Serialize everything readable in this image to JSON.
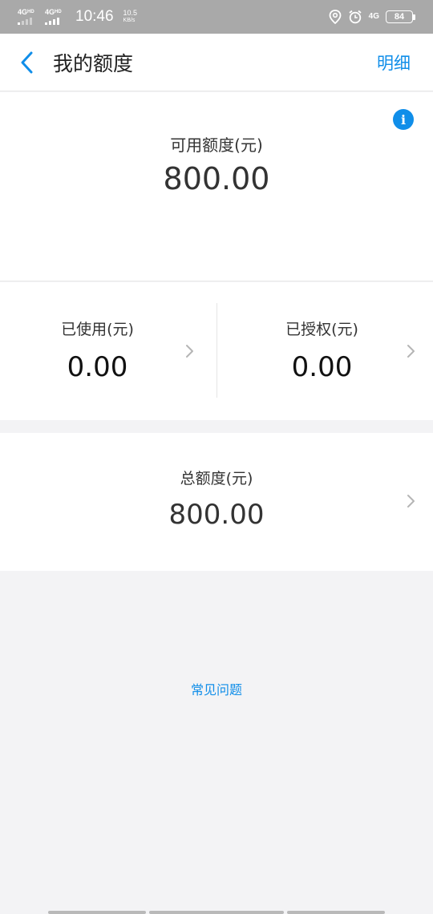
{
  "status_bar": {
    "network1": "4G",
    "network1_sup": "HD",
    "network2": "4G",
    "network2_sup": "HD",
    "time": "10:46",
    "speed_value": "10.5",
    "speed_unit": "KB/s",
    "network3": "4G",
    "battery": "84"
  },
  "header": {
    "title": "我的额度",
    "detail_link": "明细"
  },
  "available": {
    "label": "可用额度(元)",
    "value": "800.00"
  },
  "used": {
    "label": "已使用(元)",
    "value": "0.00"
  },
  "authorized": {
    "label": "已授权(元)",
    "value": "0.00"
  },
  "total": {
    "label": "总额度(元)",
    "value": "800.00"
  },
  "faq": {
    "label": "常见问题"
  },
  "colors": {
    "accent": "#108ee9",
    "status_bar": "#a9a9a9",
    "background": "#f3f3f5"
  },
  "icons": [
    "back-arrow-icon",
    "info-icon",
    "chevron-right-icon",
    "location-icon",
    "alarm-icon"
  ]
}
